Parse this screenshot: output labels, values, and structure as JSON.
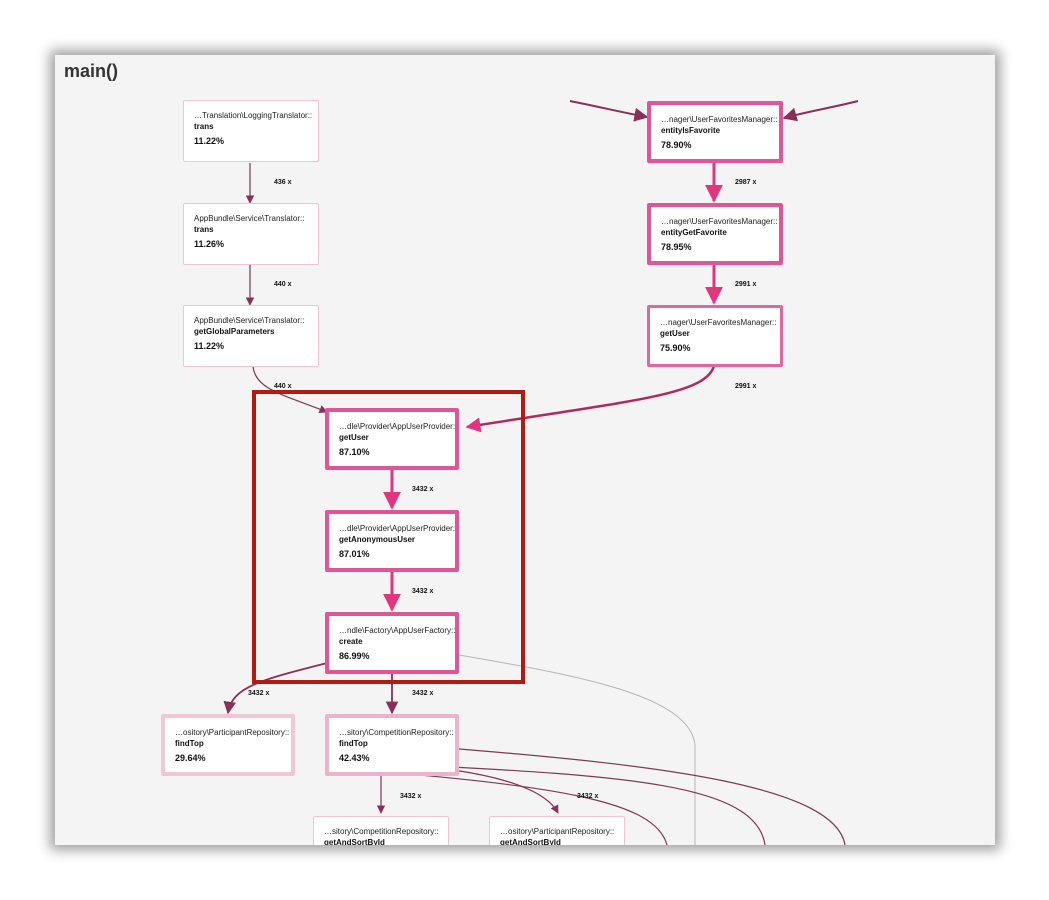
{
  "title": "main()",
  "colors": {
    "background": "#f4f4f4",
    "hot_border": "#df5696",
    "edge_hot": "#e0357f",
    "edge_dark": "#6e2a45",
    "highlight": "#b01c12"
  },
  "nodes": {
    "logging_trans": {
      "cls": "…Translation\\LoggingTranslator::",
      "fn": "trans",
      "pct": "11.22%"
    },
    "translator_trans": {
      "cls": "AppBundle\\Service\\Translator::",
      "fn": "trans",
      "pct": "11.26%"
    },
    "translator_global": {
      "cls": "AppBundle\\Service\\Translator::",
      "fn": "getGlobalParameters",
      "pct": "11.22%"
    },
    "fav_is_favorite": {
      "cls": "…nager\\UserFavoritesManager::",
      "fn": "entityIsFavorite",
      "pct": "78.90%"
    },
    "fav_get_favorite": {
      "cls": "…nager\\UserFavoritesManager::",
      "fn": "entityGetFavorite",
      "pct": "78.95%"
    },
    "fav_get_user": {
      "cls": "…nager\\UserFavoritesManager::",
      "fn": "getUser",
      "pct": "75.90%"
    },
    "provider_get_user": {
      "cls": "…dle\\Provider\\AppUserProvider::",
      "fn": "getUser",
      "pct": "87.10%"
    },
    "provider_anon": {
      "cls": "…dle\\Provider\\AppUserProvider::",
      "fn": "getAnonymousUser",
      "pct": "87.01%"
    },
    "factory_create": {
      "cls": "…ndle\\Factory\\AppUserFactory::",
      "fn": "create",
      "pct": "86.99%"
    },
    "participant_findtop": {
      "cls": "…ository\\ParticipantRepository::",
      "fn": "findTop",
      "pct": "29.64%"
    },
    "competition_findtop": {
      "cls": "…sitory\\CompetitionRepository::",
      "fn": "findTop",
      "pct": "42.43%"
    },
    "competition_getand": {
      "cls": "…sitory\\CompetitionRepository::",
      "fn": "getAndSortById",
      "pct": ""
    },
    "participant_getand": {
      "cls": "…ository\\ParticipantRepository::",
      "fn": "getAndSortById",
      "pct": ""
    }
  },
  "edge_labels": {
    "e1": "436 x",
    "e2": "440 x",
    "e3": "440 x",
    "e4": "2987 x",
    "e5": "2991 x",
    "e6": "2991 x",
    "e7": "3432 x",
    "e8": "3432 x",
    "e9": "3432 x",
    "e10": "3432 x",
    "e11": "3432 x",
    "e12": "3432 x"
  }
}
